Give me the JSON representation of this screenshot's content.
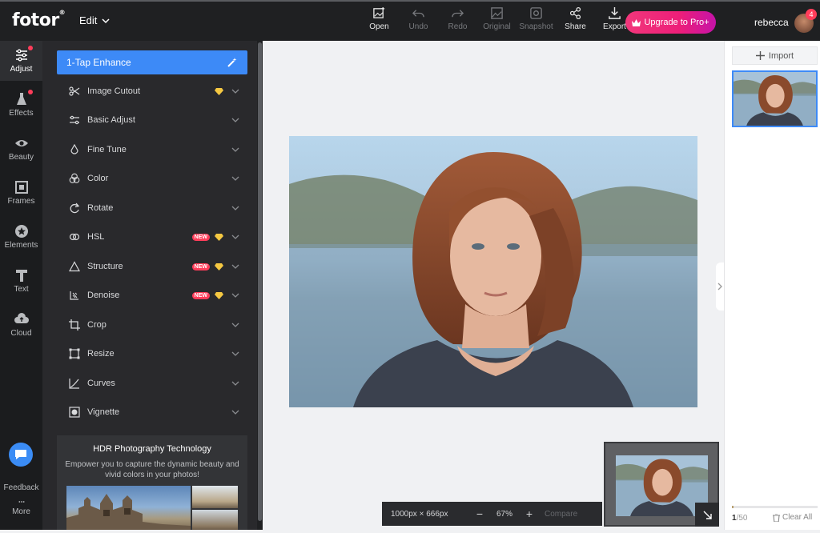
{
  "header": {
    "logo": "fotor",
    "logo_mark": "®",
    "edit_label": "Edit",
    "tools": [
      {
        "label": "Open",
        "icon": "image-plus-icon",
        "enabled": true
      },
      {
        "label": "Undo",
        "icon": "undo-icon",
        "enabled": false
      },
      {
        "label": "Redo",
        "icon": "redo-icon",
        "enabled": false
      },
      {
        "label": "Original",
        "icon": "image-icon",
        "enabled": false
      },
      {
        "label": "Snapshot",
        "icon": "camera-icon",
        "enabled": false
      },
      {
        "label": "Share",
        "icon": "share-icon",
        "enabled": true
      },
      {
        "label": "Export",
        "icon": "download-icon",
        "enabled": true
      }
    ],
    "upgrade_label": "Upgrade to Pro+",
    "username": "rebecca",
    "notification_count": "4"
  },
  "leftnav": {
    "items": [
      {
        "label": "Adjust",
        "icon": "sliders-icon",
        "active": true,
        "dot": true
      },
      {
        "label": "Effects",
        "icon": "flask-icon",
        "active": false,
        "dot": true
      },
      {
        "label": "Beauty",
        "icon": "eye-icon",
        "active": false,
        "dot": false
      },
      {
        "label": "Frames",
        "icon": "frame-icon",
        "active": false,
        "dot": false
      },
      {
        "label": "Elements",
        "icon": "star-icon",
        "active": false,
        "dot": false
      },
      {
        "label": "Text",
        "icon": "text-icon",
        "active": false,
        "dot": false
      },
      {
        "label": "Cloud",
        "icon": "cloud-icon",
        "active": false,
        "dot": false
      }
    ],
    "feedback_label": "Feedback",
    "more_label": "More"
  },
  "panel": {
    "enhance_label": "1-Tap Enhance",
    "items": [
      {
        "label": "Image Cutout",
        "icon": "scissors-icon",
        "new": false,
        "gem": true
      },
      {
        "label": "Basic Adjust",
        "icon": "sliders-icon",
        "new": false,
        "gem": false
      },
      {
        "label": "Fine Tune",
        "icon": "drop-icon",
        "new": false,
        "gem": false
      },
      {
        "label": "Color",
        "icon": "color-circles-icon",
        "new": false,
        "gem": false
      },
      {
        "label": "Rotate",
        "icon": "rotate-icon",
        "new": false,
        "gem": false
      },
      {
        "label": "HSL",
        "icon": "hsl-icon",
        "new": true,
        "gem": true
      },
      {
        "label": "Structure",
        "icon": "triangle-icon",
        "new": true,
        "gem": true
      },
      {
        "label": "Denoise",
        "icon": "denoise-icon",
        "new": true,
        "gem": true
      },
      {
        "label": "Crop",
        "icon": "crop-icon",
        "new": false,
        "gem": false
      },
      {
        "label": "Resize",
        "icon": "resize-icon",
        "new": false,
        "gem": false
      },
      {
        "label": "Curves",
        "icon": "curves-icon",
        "new": false,
        "gem": false
      },
      {
        "label": "Vignette",
        "icon": "vignette-icon",
        "new": false,
        "gem": false
      }
    ],
    "new_tag": "NEW",
    "hdr_title": "HDR Photography Technology",
    "hdr_desc": "Empower you to capture the dynamic beauty and vivid colors in your photos!"
  },
  "canvas": {
    "dimensions": "1000px × 666px",
    "zoom": "67%",
    "zoom_out": "−",
    "zoom_in": "+",
    "compare_label": "Compare"
  },
  "rightpanel": {
    "import_label": "Import",
    "counter_current": "1",
    "counter_total": "/50",
    "progress": 0.02,
    "clear_label": "Clear All"
  },
  "colors": {
    "accent": "#3d8af7",
    "upgrade_start": "#f2377b",
    "upgrade_end": "#c513a8",
    "badge": "#ff3d5a",
    "gem": "#f5c842"
  }
}
